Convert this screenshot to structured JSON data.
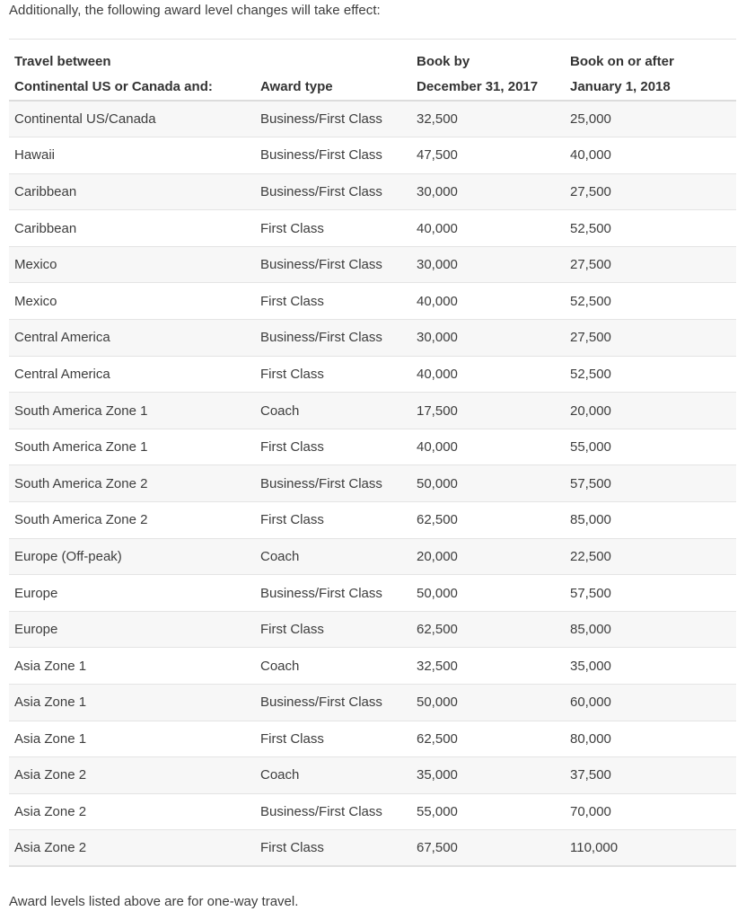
{
  "intro": "Additionally, the following award level changes will take effect:",
  "table": {
    "headers": [
      {
        "line1": "Travel between",
        "line2": "Continental US or Canada and:"
      },
      {
        "line1": "",
        "line2": "Award type"
      },
      {
        "line1": "Book by",
        "line2": "December 31, 2017"
      },
      {
        "line1": "Book on or after",
        "line2": "January 1, 2018"
      }
    ],
    "rows": [
      [
        "Continental US/Canada",
        "Business/First Class",
        "32,500",
        "25,000"
      ],
      [
        "Hawaii",
        "Business/First Class",
        "47,500",
        "40,000"
      ],
      [
        "Caribbean",
        "Business/First Class",
        "30,000",
        "27,500"
      ],
      [
        "Caribbean",
        "First Class",
        "40,000",
        "52,500"
      ],
      [
        "Mexico",
        "Business/First Class",
        "30,000",
        "27,500"
      ],
      [
        "Mexico",
        "First Class",
        "40,000",
        "52,500"
      ],
      [
        "Central America",
        "Business/First Class",
        "30,000",
        "27,500"
      ],
      [
        "Central America",
        "First Class",
        "40,000",
        "52,500"
      ],
      [
        "South America Zone 1",
        "Coach",
        "17,500",
        "20,000"
      ],
      [
        "South America Zone 1",
        "First Class",
        "40,000",
        "55,000"
      ],
      [
        "South America Zone 2",
        "Business/First Class",
        "50,000",
        "57,500"
      ],
      [
        "South America Zone 2",
        "First Class",
        "62,500",
        "85,000"
      ],
      [
        "Europe (Off-peak)",
        "Coach",
        "20,000",
        "22,500"
      ],
      [
        "Europe",
        "Business/First Class",
        "50,000",
        "57,500"
      ],
      [
        "Europe",
        "First Class",
        "62,500",
        "85,000"
      ],
      [
        "Asia Zone 1",
        "Coach",
        "32,500",
        "35,000"
      ],
      [
        "Asia Zone 1",
        "Business/First Class",
        "50,000",
        "60,000"
      ],
      [
        "Asia Zone 1",
        "First Class",
        "62,500",
        "80,000"
      ],
      [
        "Asia Zone 2",
        "Coach",
        "35,000",
        "37,500"
      ],
      [
        "Asia Zone 2",
        "Business/First Class",
        "55,000",
        "70,000"
      ],
      [
        "Asia Zone 2",
        "First Class",
        "67,500",
        "110,000"
      ]
    ]
  },
  "footer": "Award levels listed above are for one-way travel."
}
